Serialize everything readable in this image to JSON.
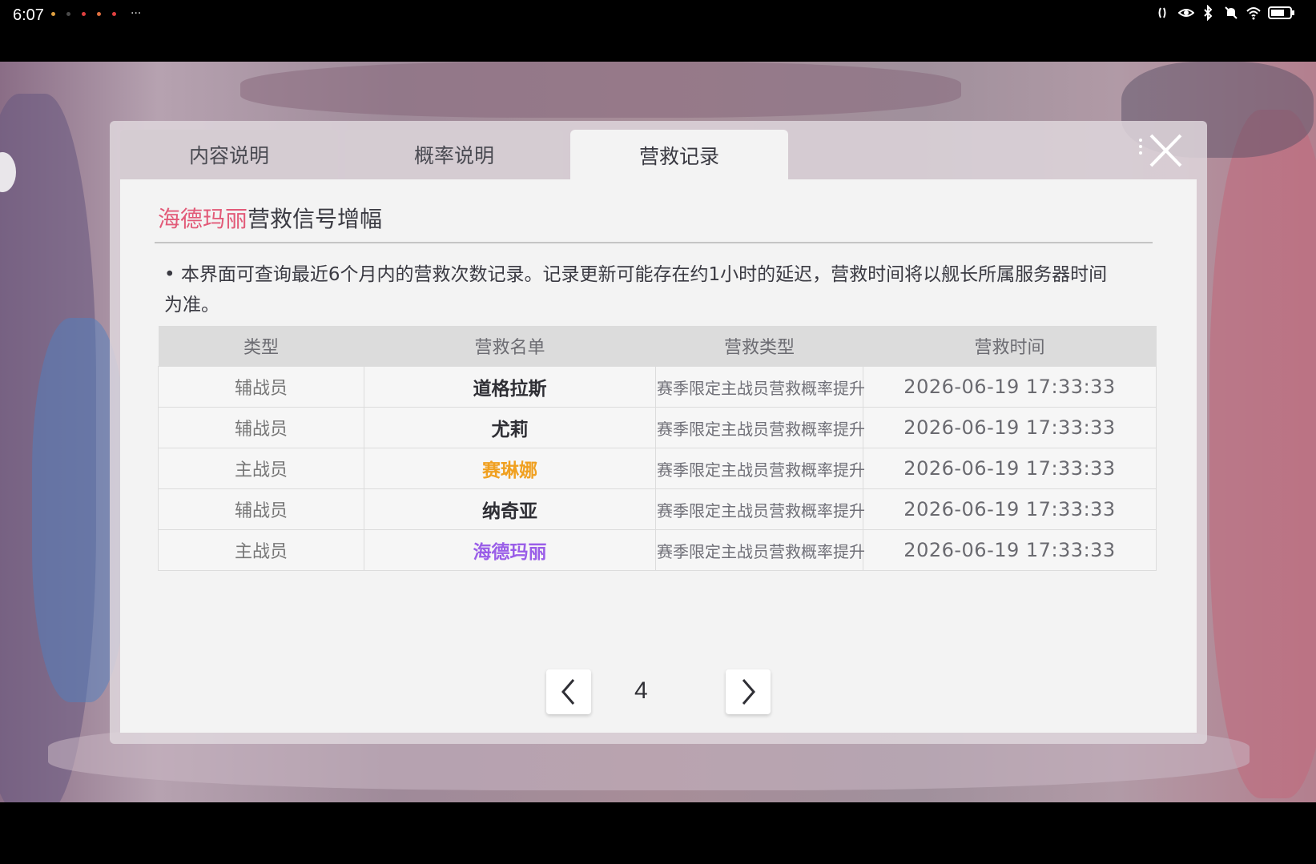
{
  "status_bar": {
    "time": "6:07",
    "more": "···",
    "dot_colors": [
      "#e0a040",
      "#4a4a4a",
      "#e04040",
      "#e07040",
      "#e04040"
    ]
  },
  "tabs": [
    {
      "label": "内容说明",
      "active": false
    },
    {
      "label": "概率说明",
      "active": false
    },
    {
      "label": "营救记录",
      "active": true
    }
  ],
  "header": {
    "highlight": "海德玛丽",
    "title": "营救信号增幅"
  },
  "notice": "• 本界面可查询最近6个月内的营救次数记录。记录更新可能存在约1小时的延迟，营救时间将以舰长所属服务器时间为准。",
  "table": {
    "columns": [
      "类型",
      "营救名单",
      "营救类型",
      "营救时间"
    ],
    "rows": [
      {
        "type": "辅战员",
        "name": "道格拉斯",
        "rescue_type": "赛季限定主战员营救概率提升",
        "time": "2026-06-19 17:33:33",
        "name_color": "#2f2f35"
      },
      {
        "type": "辅战员",
        "name": "尤莉",
        "rescue_type": "赛季限定主战员营救概率提升",
        "time": "2026-06-19 17:33:33",
        "name_color": "#2f2f35"
      },
      {
        "type": "主战员",
        "name": "赛琳娜",
        "rescue_type": "赛季限定主战员营救概率提升",
        "time": "2026-06-19 17:33:33",
        "name_color": "#f0a020"
      },
      {
        "type": "辅战员",
        "name": "纳奇亚",
        "rescue_type": "赛季限定主战员营救概率提升",
        "time": "2026-06-19 17:33:33",
        "name_color": "#2f2f35"
      },
      {
        "type": "主战员",
        "name": "海德玛丽",
        "rescue_type": "赛季限定主战员营救概率提升",
        "time": "2026-06-19 17:33:33",
        "name_color": "#9a5ee8"
      }
    ]
  },
  "pagination": {
    "page": "4"
  },
  "colors": {
    "highlight": "#e25a78",
    "orange_name": "#f0a020",
    "purple_name": "#9a5ee8"
  }
}
